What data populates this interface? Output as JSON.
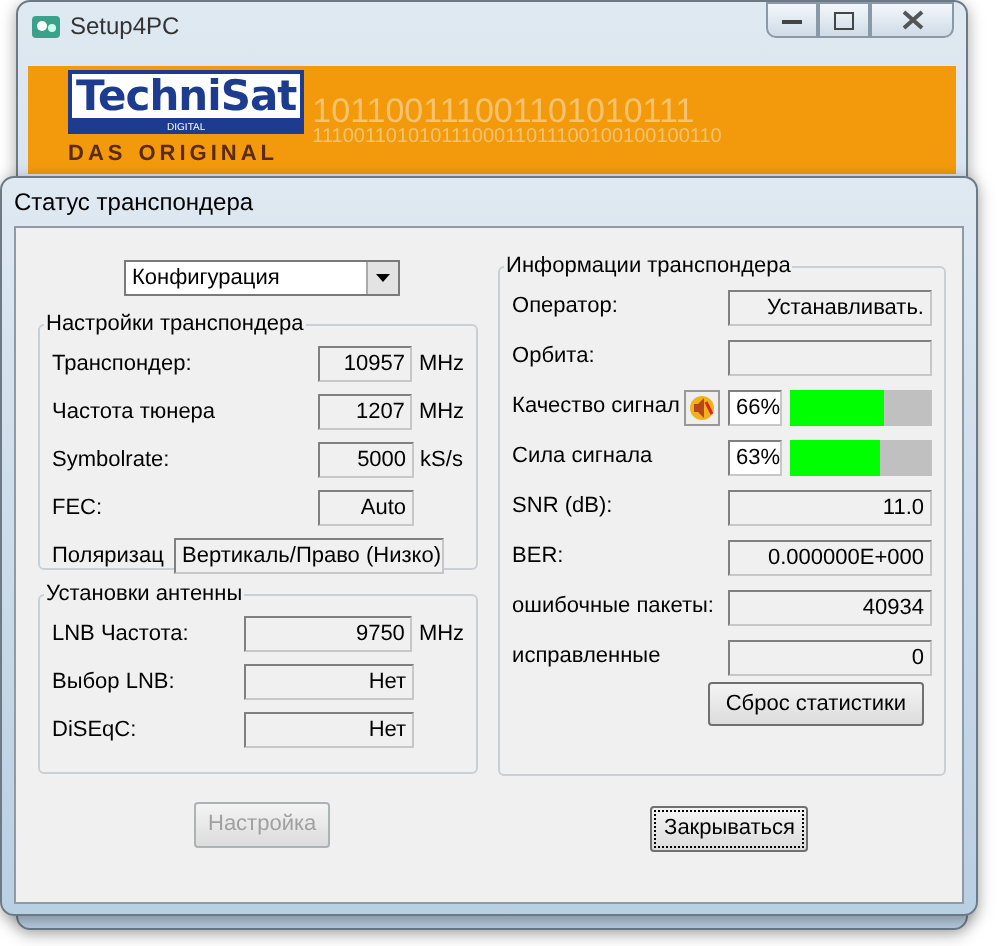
{
  "app_window": {
    "title": "Setup4PC",
    "banner": {
      "logo": "TechniSat",
      "logo_sub": "DIGITAL",
      "tagline_left": "DAS",
      "tagline_right": "ORIGINAL",
      "pattern": [
        "101100111001101010111",
        "11100110101011100011011100100100100110"
      ]
    }
  },
  "dialog": {
    "title": "Статус транспондера",
    "mode_select": {
      "value": "Конфигурация"
    },
    "transponder_settings": {
      "title": "Настройки транспондера",
      "rows": [
        {
          "kind": "field",
          "label": "Транспондер:",
          "value": "10957",
          "unit": "MHz"
        },
        {
          "kind": "field",
          "label": "Частота тюнера",
          "value": "1207",
          "unit": "MHz"
        },
        {
          "kind": "field",
          "label": "Symbolrate:",
          "value": "5000",
          "unit": "kS/s"
        },
        {
          "kind": "field",
          "label": "FEC:",
          "value": "Auto"
        },
        {
          "kind": "wide",
          "label": "Поляризац",
          "value": "Вертикаль/Право (Низко)"
        }
      ]
    },
    "antenna_settings": {
      "title": "Установки антенны",
      "rows": [
        {
          "label": "LNB Частота:",
          "value": "9750",
          "unit": "MHz"
        },
        {
          "label": "Выбор LNB:",
          "value": "Нет"
        },
        {
          "label": "DiSEqC:",
          "value": "Нет"
        }
      ]
    },
    "transponder_info": {
      "title": "Информации транспондера",
      "rows": [
        {
          "kind": "text",
          "label": "Оператор:",
          "value": "Устанавливать."
        },
        {
          "kind": "text",
          "label": "Орбита:"
        },
        {
          "kind": "meter",
          "label": "Качество сигнал",
          "icon_button": true,
          "reading": "66%",
          "level": 0.66
        },
        {
          "kind": "meter",
          "label": "Сила сигнала",
          "icon_button": false,
          "reading": "63%",
          "level": 0.63
        },
        {
          "kind": "text",
          "label": "SNR (dB):",
          "value": "11.0"
        },
        {
          "kind": "text",
          "label": "BER:",
          "value": "0.000000E+000"
        },
        {
          "kind": "text",
          "label": "ошибочные пакеты:",
          "value": "40934"
        },
        {
          "kind": "text",
          "label": "исправленные",
          "value": "0"
        }
      ],
      "reset_button": {
        "label": "Сброс статистики"
      }
    },
    "setup_button": {
      "label": "Настройка",
      "disabled": true
    },
    "close_button": {
      "label": "Закрываться",
      "focused": true
    }
  }
}
